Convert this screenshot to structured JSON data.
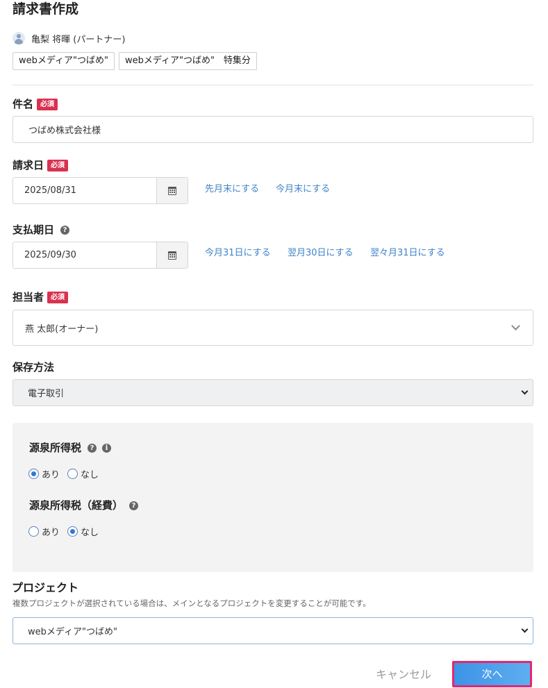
{
  "page": {
    "title": "請求書作成"
  },
  "user": {
    "name": "亀梨 将暉 (パートナー)"
  },
  "tags": [
    "webメディア\"つばめ\"",
    "webメディア\"つばめ\"　特集分"
  ],
  "subject": {
    "label": "件名",
    "required": "必須",
    "value": "つばめ株式会社様"
  },
  "invoice_date": {
    "label": "請求日",
    "required": "必須",
    "value": "2025/08/31",
    "links": [
      "先月末にする",
      "今月末にする"
    ]
  },
  "due_date": {
    "label": "支払期日",
    "help": "?",
    "value": "2025/09/30",
    "links": [
      "今月31日にする",
      "翌月30日にする",
      "翌々月31日にする"
    ]
  },
  "assignee": {
    "label": "担当者",
    "required": "必須",
    "value": "燕 太郎(オーナー)"
  },
  "storage": {
    "label": "保存方法",
    "value": "電子取引"
  },
  "withholding": {
    "label": "源泉所得税",
    "help": "?",
    "info": "i",
    "options": [
      {
        "label": "あり",
        "checked": true
      },
      {
        "label": "なし",
        "checked": false
      }
    ]
  },
  "withholding_expense": {
    "label": "源泉所得税（経費）",
    "help": "?",
    "options": [
      {
        "label": "あり",
        "checked": false
      },
      {
        "label": "なし",
        "checked": true
      }
    ]
  },
  "project": {
    "label": "プロジェクト",
    "description": "複数プロジェクトが選択されている場合は、メインとなるプロジェクトを変更することが可能です。",
    "value": "webメディア\"つばめ\""
  },
  "actions": {
    "cancel": "キャンセル",
    "next": "次へ"
  },
  "colors": {
    "link": "#3f83c7",
    "required": "#d9314f",
    "accent": "#3d93e6",
    "highlight": "#e5266e"
  }
}
